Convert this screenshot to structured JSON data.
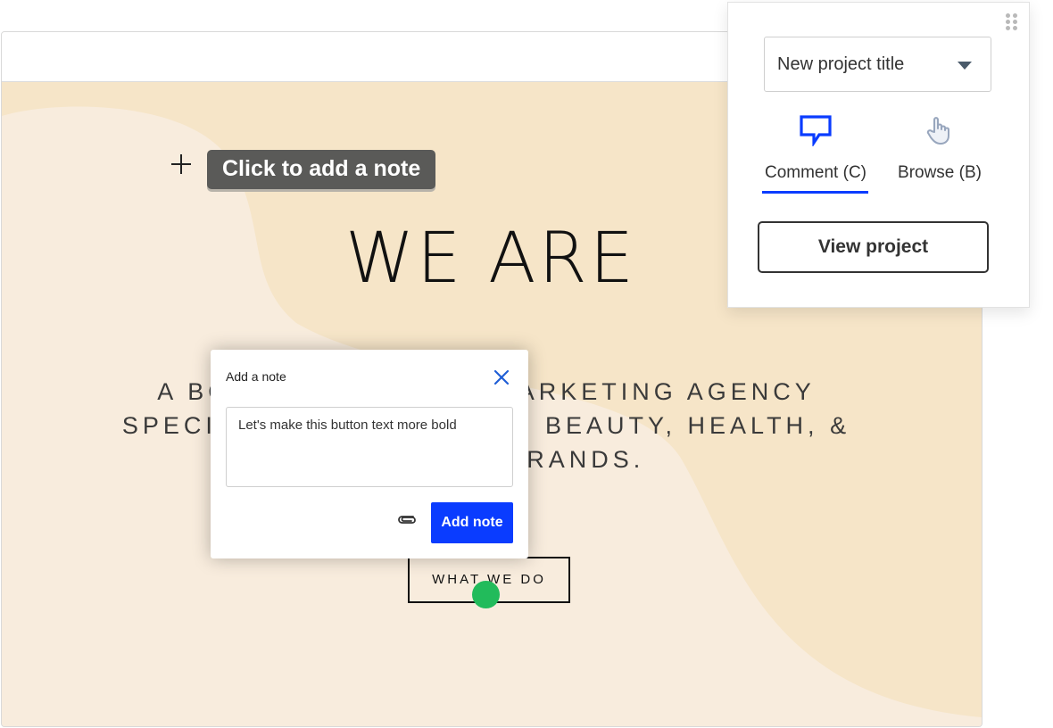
{
  "tooltip": {
    "text": "Click to add a note"
  },
  "hero": {
    "heading": "WE ARE",
    "sub_line1": "A BOUTIQUE DIGITAL MARKETING AGENCY",
    "sub_line2": "SPECIALIZING IN LEADING BEAUTY, HEALTH, &",
    "sub_line3": "WELLNESS BRANDS.",
    "cta_label": "WHAT WE DO"
  },
  "note_dialog": {
    "title": "Add a note",
    "textarea_value": "Let's make this button text more bold",
    "submit_label": "Add note"
  },
  "tool_panel": {
    "project_title": "New project title",
    "tabs": [
      {
        "label": "Comment (C)",
        "icon": "comment-icon",
        "active": true
      },
      {
        "label": "Browse (B)",
        "icon": "pointer-hand-icon",
        "active": false
      }
    ],
    "view_button_label": "View project"
  },
  "colors": {
    "accent": "#0a3cff",
    "pin": "#22bb5b",
    "page_background": "#f8ecdd",
    "blob": "#f6e5c8",
    "tooltip_background": "#5a5a58"
  }
}
